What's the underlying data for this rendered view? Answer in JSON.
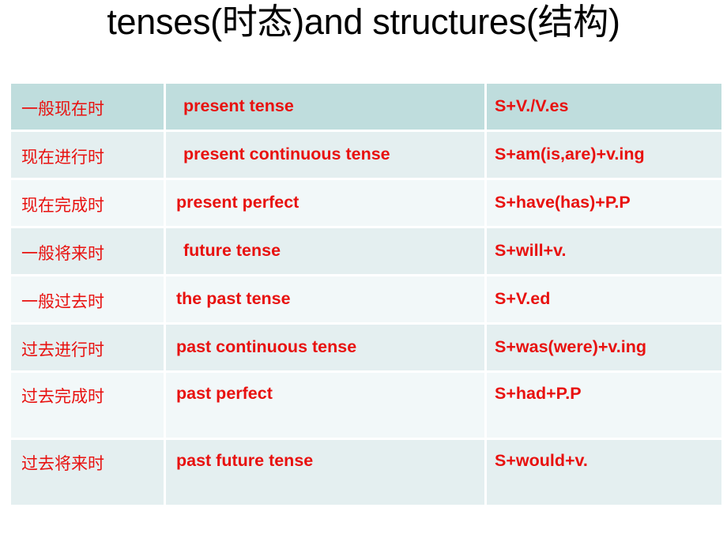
{
  "slide": {
    "title": "tenses(时态)and structures(结构)",
    "title_color": "#000000",
    "background_color": "#ffffff"
  },
  "table": {
    "accent_text_color": "#e8110f",
    "header_row_color": "#bfdddd",
    "row_color_a": "#e4eff0",
    "row_color_b": "#f2f8f9",
    "gridline_color": "#ffffff",
    "columns": [
      "tense_cn",
      "tense_en",
      "structure"
    ],
    "rows": [
      {
        "tense_cn": "一般现在时",
        "tense_en": " present tense",
        "structure": "S+V./V.es"
      },
      {
        "tense_cn": "现在进行时",
        "tense_en": " present continuous tense",
        "structure": "S+am(is,are)+v.ing"
      },
      {
        "tense_cn": "现在完成时",
        "tense_en": "present perfect",
        "structure": "S+have(has)+P.P"
      },
      {
        "tense_cn": "一般将来时",
        "tense_en": " future tense",
        "structure": "S+will+v."
      },
      {
        "tense_cn": "一般过去时",
        "tense_en": "the past tense",
        "structure": "S+V.ed"
      },
      {
        "tense_cn": "过去进行时",
        "tense_en": "past continuous tense",
        "structure": "S+was(were)+v.ing"
      },
      {
        "tense_cn": "过去完成时",
        "tense_en": "past perfect",
        "structure": "S+had+P.P"
      },
      {
        "tense_cn": "过去将来时",
        "tense_en": "past future tense",
        "structure": "S+would+v."
      }
    ]
  }
}
